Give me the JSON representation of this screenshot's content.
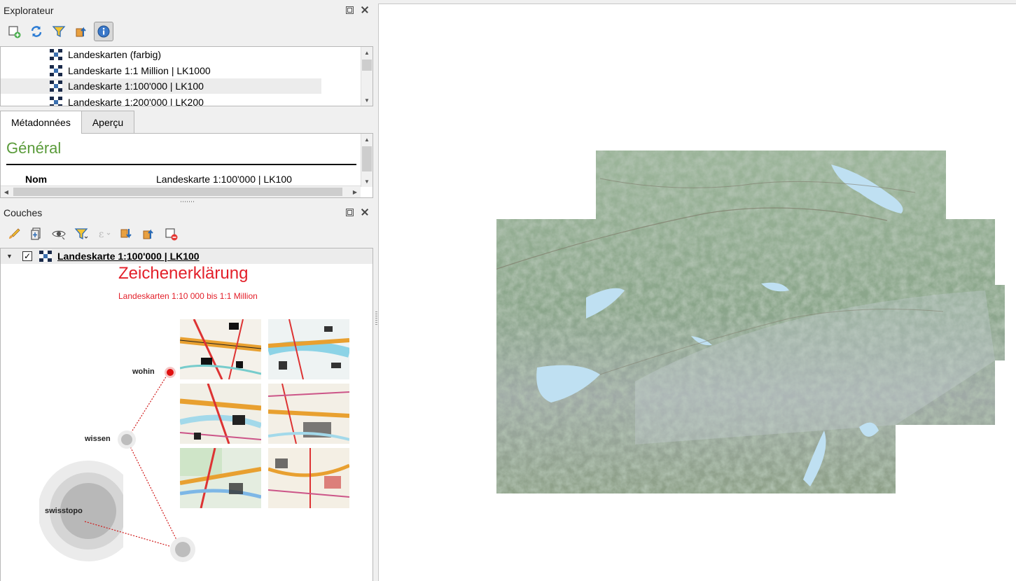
{
  "explorer": {
    "title": "Explorateur",
    "toolbar": [
      {
        "icon": "add-layer-icon"
      },
      {
        "icon": "refresh-icon"
      },
      {
        "icon": "filter-icon"
      },
      {
        "icon": "collapse-all-icon"
      },
      {
        "icon": "info-icon"
      }
    ],
    "items": [
      {
        "label": "Landeskarten (farbig)",
        "icon": "wms-layer-icon"
      },
      {
        "label": "Landeskarte 1:1 Million | LK1000",
        "icon": "wms-layer-icon"
      },
      {
        "label": "Landeskarte 1:100'000 | LK100",
        "icon": "wms-layer-icon",
        "selected": true
      },
      {
        "label": "Landeskarte 1:200'000 | LK200",
        "icon": "wms-layer-icon"
      }
    ]
  },
  "details": {
    "tabs": [
      {
        "label": "Métadonnées",
        "active": true
      },
      {
        "label": "Aperçu",
        "active": false
      }
    ],
    "heading": "Général",
    "rows": [
      {
        "key": "Nom",
        "value": "Landeskarte 1:100'000 | LK100"
      }
    ]
  },
  "layers": {
    "title": "Couches",
    "layer": {
      "name": "Landeskarte 1:100'000 | LK100",
      "checked": true,
      "check_glyph": "✓"
    },
    "legend": {
      "title": "Zeichenerklärung",
      "subtitle": "Landeskarten 1:10 000 bis 1:1 Million",
      "nodes": {
        "wohin": "wohin",
        "wissen": "wissen",
        "swisstopo": "swisstopo"
      }
    }
  },
  "colors": {
    "accent_green": "#5a9b3a",
    "legend_red": "#e3202a",
    "map_green": "#8aa58a"
  }
}
